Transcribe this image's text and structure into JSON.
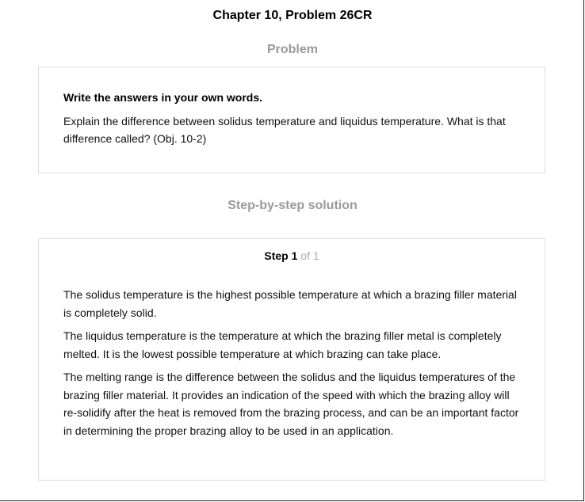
{
  "page": {
    "title": "Chapter 10, Problem 26CR"
  },
  "problem": {
    "heading": "Problem",
    "instruction": "Write the answers in your own words.",
    "text": "Explain the difference between solidus temperature and liquidus temperature. What is that difference called? (Obj. 10-2)"
  },
  "solution": {
    "heading": "Step-by-step solution",
    "step_label": "Step",
    "step_number": "1",
    "step_of": "of 1",
    "paragraphs": [
      "The solidus temperature is the highest possible temperature at which a brazing filler material is completely solid.",
      "The liquidus temperature is the temperature at which the brazing filler metal is completely melted. It is the lowest possible temperature at which brazing can take place.",
      "The melting range is the difference between the solidus and the liquidus temperatures of the brazing filler material. It provides an indication of the speed with which the brazing alloy will re-solidify after the heat is removed from the brazing process, and can be an important factor in determining the proper brazing alloy to be used in an application."
    ]
  }
}
